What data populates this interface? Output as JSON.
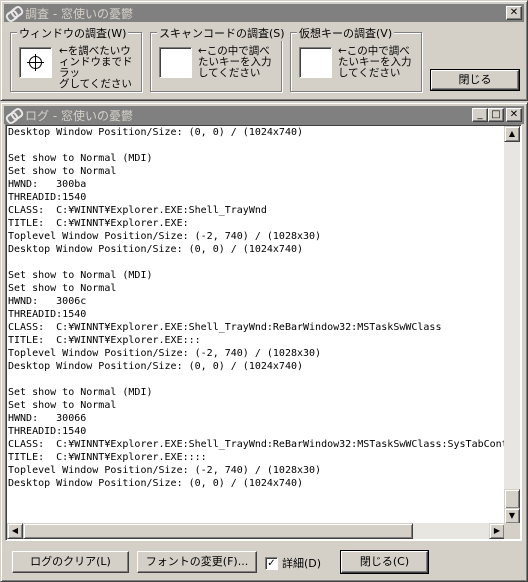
{
  "investigate_window": {
    "title": "調査 - 窓使いの憂鬱",
    "title_buttons": [
      "✕"
    ],
    "groups": [
      {
        "legend": "ウィンドウの調査(W)",
        "description": "←を調べたいウ\nィンドウまでドラッ\nグしてください"
      },
      {
        "legend": "スキャンコードの調査(S)",
        "description": "←この中で調べ\nたいキーを入力\nしてください"
      },
      {
        "legend": "仮想キーの調査(V)",
        "description": "←この中で調べ\nたいキーを入力\nしてください"
      }
    ],
    "close_button": "閉じる"
  },
  "log_window": {
    "title": "ログ - 窓使いの憂鬱",
    "title_buttons": [
      "_",
      "□",
      "✕"
    ],
    "lines": [
      "Desktop Window Position/Size: (0, 0) / (1024x740)",
      "",
      "Set show to Normal (MDI)",
      "Set show to Normal",
      "HWND:   300ba",
      "THREADID:1540",
      "CLASS:  C:¥WINNT¥Explorer.EXE:Shell_TrayWnd",
      "TITLE:  C:¥WINNT¥Explorer.EXE:",
      "Toplevel Window Position/Size: (-2, 740) / (1028x30)",
      "Desktop Window Position/Size: (0, 0) / (1024x740)",
      "",
      "Set show to Normal (MDI)",
      "Set show to Normal",
      "HWND:   3006c",
      "THREADID:1540",
      "CLASS:  C:¥WINNT¥Explorer.EXE:Shell_TrayWnd:ReBarWindow32:MSTaskSwWClass",
      "TITLE:  C:¥WINNT¥Explorer.EXE:::",
      "Toplevel Window Position/Size: (-2, 740) / (1028x30)",
      "Desktop Window Position/Size: (0, 0) / (1024x740)",
      "",
      "Set show to Normal (MDI)",
      "Set show to Normal",
      "HWND:   30066",
      "THREADID:1540",
      "CLASS:  C:¥WINNT¥Explorer.EXE:Shell_TrayWnd:ReBarWindow32:MSTaskSwWClass:SysTabCont",
      "TITLE:  C:¥WINNT¥Explorer.EXE::::",
      "Toplevel Window Position/Size: (-2, 740) / (1028x30)",
      "Desktop Window Position/Size: (0, 0) / (1024x740)"
    ],
    "buttons": {
      "clear_log": "ログのクリア(L)",
      "change_font": "フォントの変更(F)...",
      "detail_label": "詳細(D)",
      "detail_checked": "✓",
      "close": "閉じる(C)"
    },
    "scroll": {
      "up": "▲",
      "down": "▼",
      "left": "◀",
      "right": "▶"
    }
  }
}
